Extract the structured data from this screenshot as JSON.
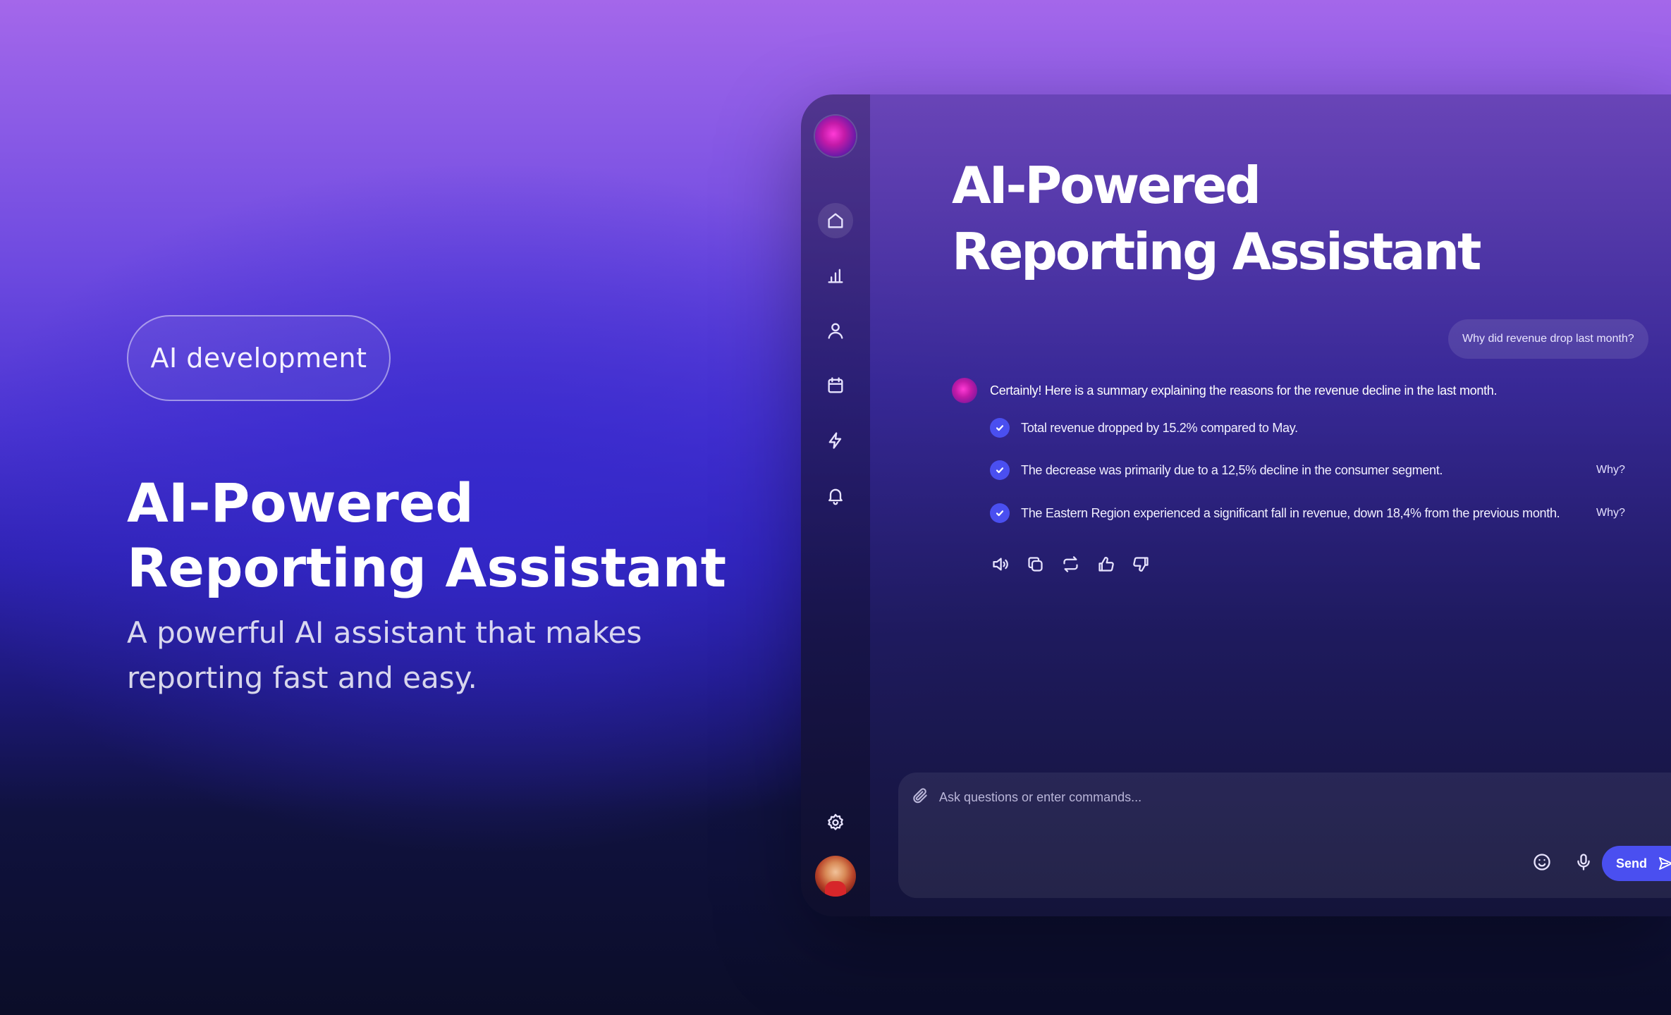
{
  "hero": {
    "tag": "AI development",
    "title": "AI-Powered Reporting Assistant",
    "subtitle": "A powerful AI assistant that makes reporting fast and easy."
  },
  "sidebar": {
    "items": [
      {
        "name": "home",
        "icon": "home-icon",
        "active": true
      },
      {
        "name": "analytics",
        "icon": "bar-chart-icon"
      },
      {
        "name": "users",
        "icon": "user-icon"
      },
      {
        "name": "calendar",
        "icon": "calendar-icon"
      },
      {
        "name": "automation",
        "icon": "lightning-icon"
      },
      {
        "name": "notifications",
        "icon": "bell-icon"
      }
    ],
    "bottom": [
      {
        "name": "settings",
        "icon": "gear-icon"
      },
      {
        "name": "profile",
        "icon": "avatar"
      }
    ]
  },
  "app": {
    "title": "AI-Powered Reporting Assistant"
  },
  "chat": {
    "user_message": "Why did revenue drop last month?",
    "ai_intro": "Certainly! Here is a summary explaining the reasons for the revenue decline in the last month.",
    "bullets": [
      {
        "text": "Total revenue dropped by 15.2% compared to May.",
        "why": ""
      },
      {
        "text": "The decrease was primarily due to a 12,5% decline in the consumer segment.",
        "why": "Why?"
      },
      {
        "text": "The Eastern Region experienced a significant fall in revenue, down 18,4% from the previous month.",
        "why": "Why?"
      }
    ],
    "actions": [
      "speaker-icon",
      "copy-icon",
      "regenerate-icon",
      "thumbs-up-icon",
      "thumbs-down-icon"
    ]
  },
  "composer": {
    "placeholder": "Ask questions or enter commands...",
    "send_label": "Send"
  },
  "colors": {
    "accent": "#4a4ff0",
    "bg_top": "#a467ea",
    "bg_bottom": "#0b0d28"
  }
}
